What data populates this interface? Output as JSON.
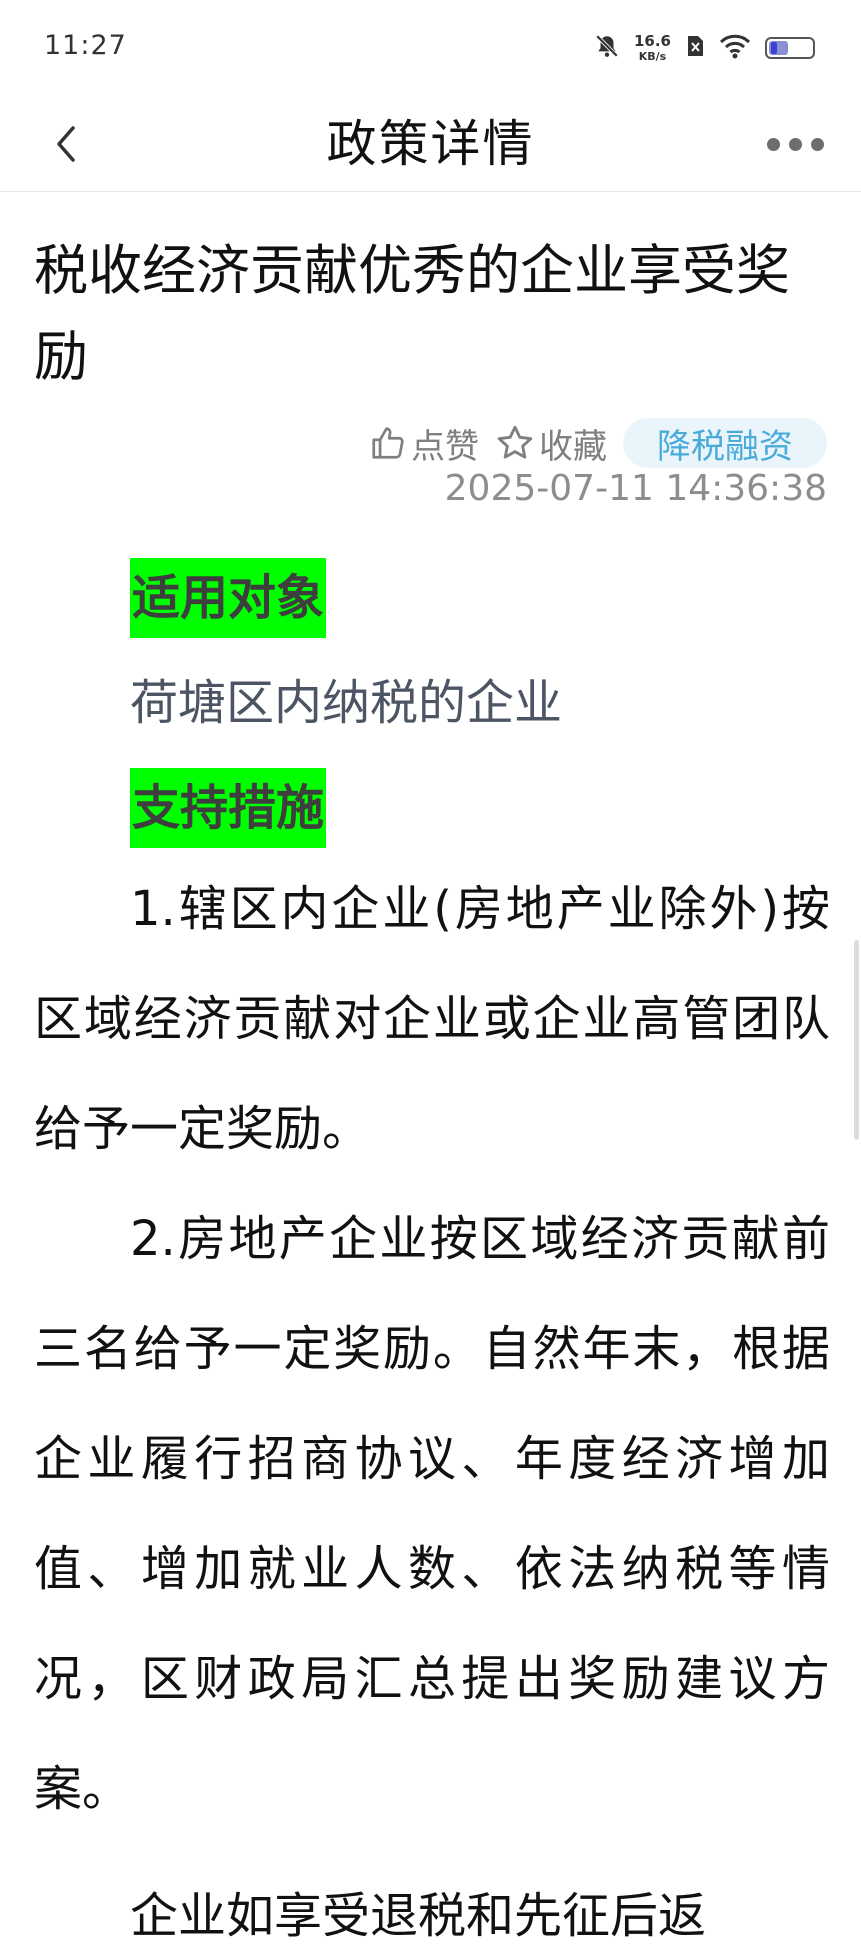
{
  "status_bar": {
    "time": "11:27",
    "net_speed_value": "16.6",
    "net_speed_unit": "KB/s",
    "icons": [
      "mute-bell-icon",
      "sim-off-icon",
      "wifi-icon",
      "battery-icon"
    ],
    "battery_level": 0.45
  },
  "nav": {
    "title": "政策详情",
    "back_icon": "chevron-left-icon",
    "more_icon": "more-dots-icon"
  },
  "article": {
    "title": "税收经济贡献优秀的企业享受奖励",
    "like_label": "点赞",
    "favorite_label": "收藏",
    "tag": "降税融资",
    "publish_time": "2025-07-11 14:36:38",
    "colors": {
      "tag_text": "#49abd9",
      "tag_bg": "#eaf5fb",
      "heading_highlight": "#00ff00"
    }
  },
  "content": {
    "heading_target": "适用对象",
    "target_text": "荷塘区内纳税的企业",
    "heading_measures": "支持措施",
    "paragraphs": [
      "1.辖区内企业(房地产业除外)按区域经济贡献对企业或企业高管团队给予一定奖励。",
      "2.房地产企业按区域经济贡献前三名给予一定奖励。自然年末，根据企业履行招商协议、年度经济增加值、增加就业人数、依法纳税等情况，区财政局汇总提出奖励建议方案。"
    ],
    "partial_line": "企业如享受退税和先征后返"
  }
}
